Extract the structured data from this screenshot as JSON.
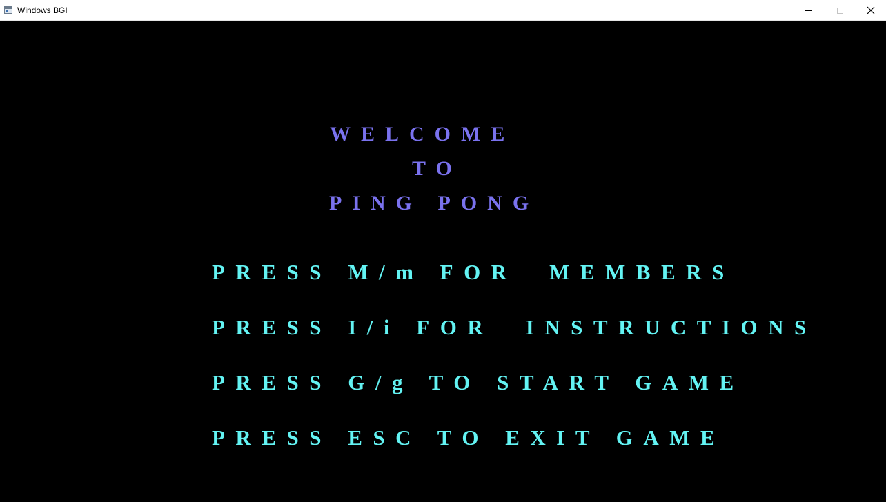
{
  "window": {
    "title": "Windows BGI",
    "icon": "app-window-icon",
    "controls": {
      "minimize": "minimize-icon",
      "maximize": "maximize-icon",
      "close": "close-icon"
    }
  },
  "screen": {
    "background": "#000000",
    "welcome_color": "#7a72ee",
    "menu_color": "#63f3f3",
    "welcome_lines": [
      "WELCOME",
      "TO",
      "PING PONG"
    ],
    "menu_lines": [
      "PRESS M/m FOR  MEMBERS",
      "PRESS I/i FOR  INSTRUCTIONS",
      "PRESS G/g TO START GAME",
      "PRESS ESC TO EXIT GAME"
    ]
  }
}
